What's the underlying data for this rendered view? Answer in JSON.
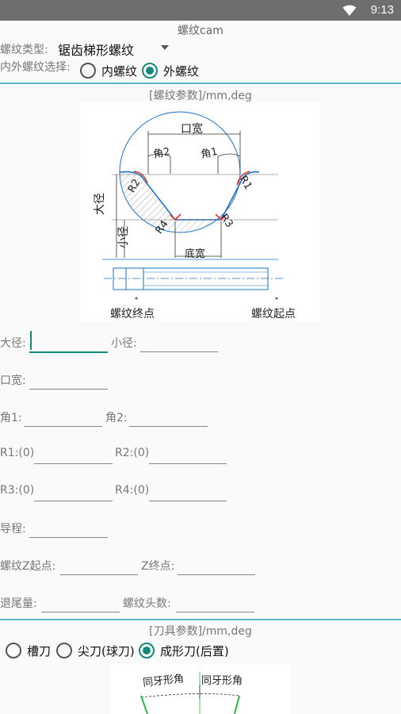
{
  "status": {
    "time": "9:13"
  },
  "app": {
    "title": "螺纹cam"
  },
  "thread_type": {
    "label": "螺纹类型:",
    "value": "锯齿梯形螺纹"
  },
  "inout": {
    "label": "内外螺纹选择:",
    "options": [
      "内螺纹",
      "外螺纹"
    ],
    "selected": 1
  },
  "thread_params": {
    "heading": "[螺纹参数]/mm,deg"
  },
  "diagram": {
    "labels": {
      "mouth_width": "口宽",
      "angle2": "角2",
      "angle1": "角1",
      "r1": "R1",
      "r2": "R2",
      "r3": "R3",
      "r4": "R4",
      "major_dia": "大径",
      "minor_dia": "小径",
      "bottom_width": "底宽",
      "end_point": "螺纹终点",
      "start_point": "螺纹起点"
    }
  },
  "fields": {
    "major_dia": {
      "label": "大径:",
      "value": ""
    },
    "minor_dia": {
      "label": "小径:",
      "value": ""
    },
    "mouth_width": {
      "label": "口宽:",
      "value": ""
    },
    "angle1": {
      "label": "角1:",
      "value": ""
    },
    "angle2": {
      "label": "角2:",
      "value": ""
    },
    "r1": {
      "label": "R1:(0)",
      "value": ""
    },
    "r2": {
      "label": "R2:(0)",
      "value": ""
    },
    "r3": {
      "label": "R3:(0)",
      "value": ""
    },
    "r4": {
      "label": "R4:(0)",
      "value": ""
    },
    "lead": {
      "label": "导程:",
      "value": ""
    },
    "z_start": {
      "label": "螺纹Z起点:",
      "value": ""
    },
    "z_end": {
      "label": "Z终点:",
      "value": ""
    },
    "retract": {
      "label": "退尾量:",
      "value": ""
    },
    "starts": {
      "label": "螺纹头数:",
      "value": ""
    }
  },
  "tool_params": {
    "heading": "[刀具参数]/mm,deg"
  },
  "tool_type": {
    "options": [
      "槽刀",
      "尖刀(球刀)",
      "成形刀(后置)"
    ],
    "selected": 2
  },
  "tool_diagram": {
    "labels": {
      "left_angle": "同牙形角",
      "right_angle": "同牙形角"
    }
  },
  "colors": {
    "accent": "#14897a",
    "divider": "#5bb7c7",
    "diagram_blue": "#1a73c9",
    "diagram_red": "#e0332b"
  }
}
